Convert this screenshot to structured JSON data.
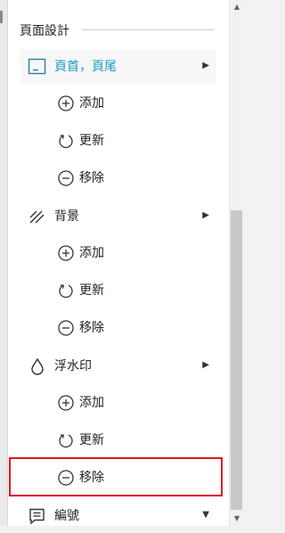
{
  "panel": {
    "section_title": "頁面設計",
    "groups": [
      {
        "label": "頁首，頁尾",
        "icon": "header-footer-icon",
        "selected": true,
        "items": [
          {
            "label": "添加",
            "icon": "plus-circle-icon"
          },
          {
            "label": "更新",
            "icon": "refresh-icon"
          },
          {
            "label": "移除",
            "icon": "minus-circle-icon"
          }
        ]
      },
      {
        "label": "背景",
        "icon": "background-icon",
        "items": [
          {
            "label": "添加",
            "icon": "plus-circle-icon"
          },
          {
            "label": "更新",
            "icon": "refresh-icon"
          },
          {
            "label": "移除",
            "icon": "minus-circle-icon"
          }
        ]
      },
      {
        "label": "浮水印",
        "icon": "watermark-drop-icon",
        "items": [
          {
            "label": "添加",
            "icon": "plus-circle-icon"
          },
          {
            "label": "更新",
            "icon": "refresh-icon"
          },
          {
            "label": "移除",
            "icon": "minus-circle-icon"
          }
        ]
      },
      {
        "label": "編號",
        "icon": "numbering-icon"
      }
    ]
  },
  "colors": {
    "accent": "#1a9ac2",
    "highlight": "#e0141e"
  }
}
